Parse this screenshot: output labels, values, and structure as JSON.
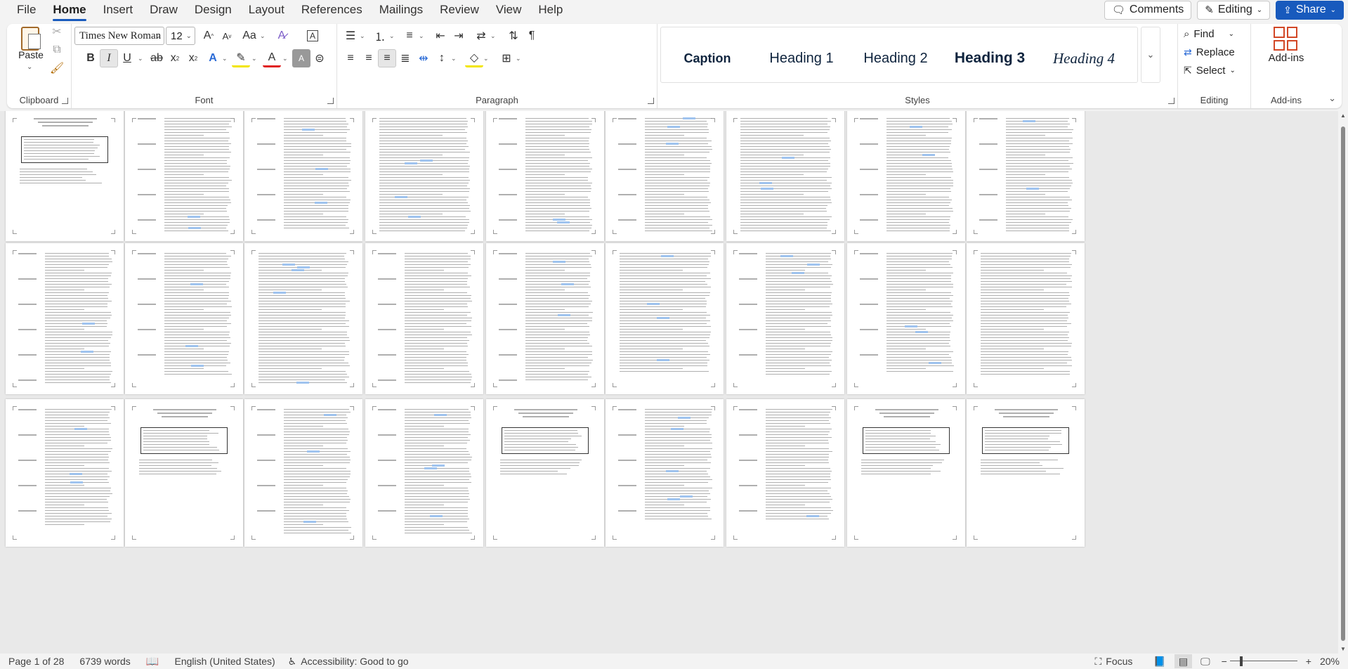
{
  "menu": {
    "tabs": [
      "File",
      "Home",
      "Insert",
      "Draw",
      "Design",
      "Layout",
      "References",
      "Mailings",
      "Review",
      "View",
      "Help"
    ],
    "active_tab": "Home",
    "comments_label": "Comments",
    "editing_label": "Editing",
    "share_label": "Share"
  },
  "ribbon": {
    "clipboard": {
      "label": "Clipboard",
      "paste_label": "Paste"
    },
    "font": {
      "label": "Font",
      "font_name": "Times New Roman",
      "font_size": "12"
    },
    "paragraph": {
      "label": "Paragraph"
    },
    "styles": {
      "label": "Styles",
      "items": [
        "Caption",
        "Heading 1",
        "Heading 2",
        "Heading 3",
        "Heading 4"
      ]
    },
    "editing": {
      "label": "Editing",
      "find_label": "Find",
      "replace_label": "Replace",
      "select_label": "Select"
    },
    "addins": {
      "label": "Add-ins",
      "button_label": "Add-ins"
    }
  },
  "statusbar": {
    "page": "Page 1 of 28",
    "words": "6739 words",
    "language": "English (United States)",
    "accessibility": "Accessibility: Good to go",
    "focus": "Focus",
    "zoom": "20%"
  },
  "colors": {
    "accent": "#185abd",
    "ribbon_bg": "#ffffff",
    "app_bg": "#f3f3f3",
    "doc_bg": "#e9e9e9"
  }
}
